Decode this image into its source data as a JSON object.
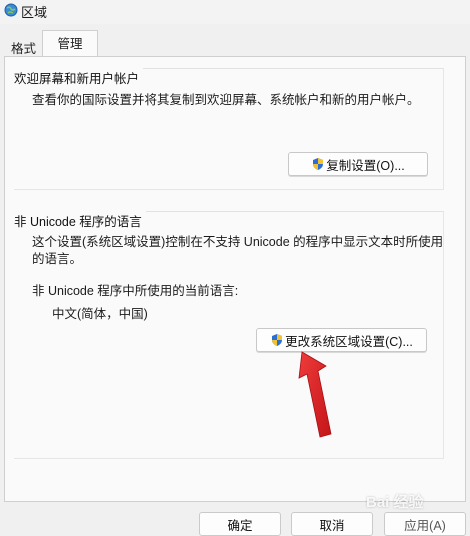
{
  "window": {
    "title": "区域"
  },
  "tabs": [
    {
      "label": "格式"
    },
    {
      "label": "管理",
      "active": true
    }
  ],
  "welcome_group": {
    "title": "欢迎屏幕和新用户帐户",
    "description": "查看你的国际设置并将其复制到欢迎屏幕、系统帐户和新的用户帐户。",
    "button_label": "复制设置(O)..."
  },
  "unicode_group": {
    "title": "非 Unicode 程序的语言",
    "description_line1": "这个设置(系统区域设置)控制在不支持 Unicode 的程序中显示文本时所使用",
    "description_line2": "的语言。",
    "current_label": "非 Unicode 程序中所使用的当前语言:",
    "current_value": "中文(简体，中国)",
    "button_label": "更改系统区域设置(C)..."
  },
  "footer": {
    "ok_label": "确定",
    "cancel_label": "取消",
    "apply_label": "应用(A)"
  },
  "watermark": "Bai 经验",
  "icons": {
    "title": "globe-icon",
    "buttons": "uac-shield-icon",
    "annotation": "red-arrow"
  },
  "colors": {
    "arrow": "#e0262a",
    "shield_blue": "#2a6fd6",
    "shield_yellow": "#f2c230"
  }
}
